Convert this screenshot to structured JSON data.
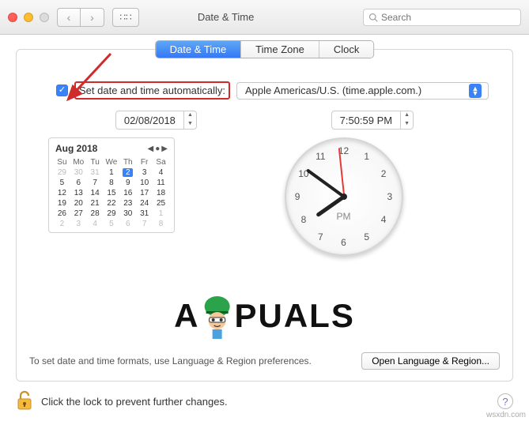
{
  "window": {
    "title": "Date & Time",
    "search_placeholder": "Search"
  },
  "tabs": {
    "date_time": "Date & Time",
    "time_zone": "Time Zone",
    "clock": "Clock"
  },
  "auto": {
    "label": "Set date and time automatically:",
    "server": "Apple Americas/U.S. (time.apple.com.)"
  },
  "date_field": "02/08/2018",
  "time_field": "7:50:59 PM",
  "calendar": {
    "month_label": "Aug 2018",
    "dow": [
      "Su",
      "Mo",
      "Tu",
      "We",
      "Th",
      "Fr",
      "Sa"
    ],
    "lead_muted": [
      "29",
      "30",
      "31"
    ],
    "days": [
      "1",
      "2",
      "3",
      "4",
      "5",
      "6",
      "7",
      "8",
      "9",
      "10",
      "11",
      "12",
      "13",
      "14",
      "15",
      "16",
      "17",
      "18",
      "19",
      "20",
      "21",
      "22",
      "23",
      "24",
      "25",
      "26",
      "27",
      "28",
      "29",
      "30",
      "31"
    ],
    "trail_muted": [
      "1",
      "2",
      "3",
      "4",
      "5",
      "6",
      "7",
      "8"
    ],
    "selected": "2"
  },
  "clock": {
    "ampm": "PM",
    "numbers": [
      "12",
      "1",
      "2",
      "3",
      "4",
      "5",
      "6",
      "7",
      "8",
      "9",
      "10",
      "11"
    ]
  },
  "panel_footer": {
    "hint": "To set date and time formats, use Language & Region preferences.",
    "button": "Open Language & Region..."
  },
  "lock_text": "Click the lock to prevent further changes.",
  "watermark": {
    "left": "A",
    "right": "PUALS"
  },
  "credit": "wsxdn.com"
}
